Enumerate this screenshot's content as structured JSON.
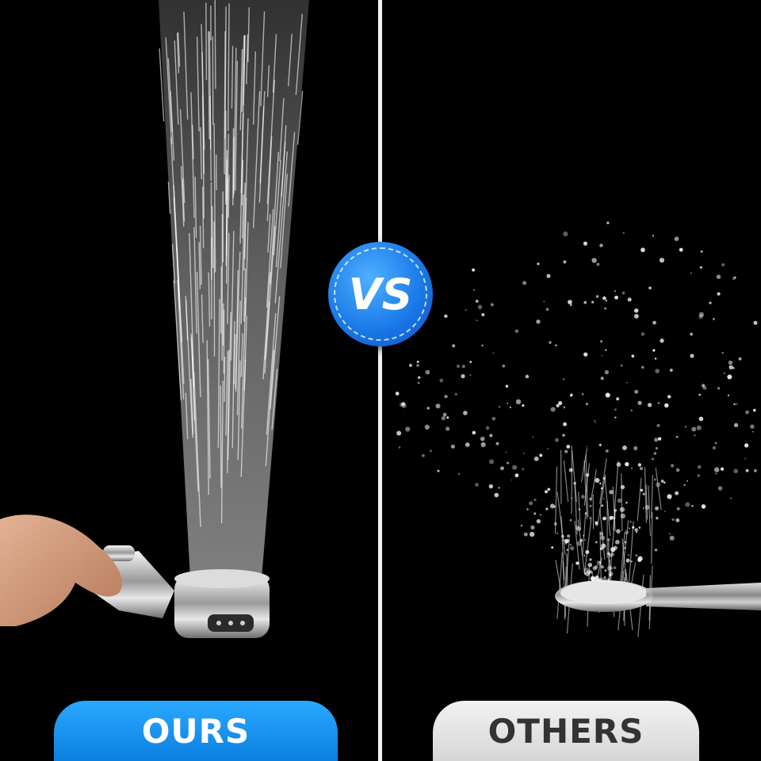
{
  "left_label": "OURS",
  "right_label": "OTHERS",
  "badge_text": "VS",
  "colors": {
    "background": "#000000",
    "divider": "#f2f2f2",
    "ours_badge": "#1a8cf0",
    "others_badge": "#e0e0e0",
    "vs_badge": "#1a7ae8"
  }
}
